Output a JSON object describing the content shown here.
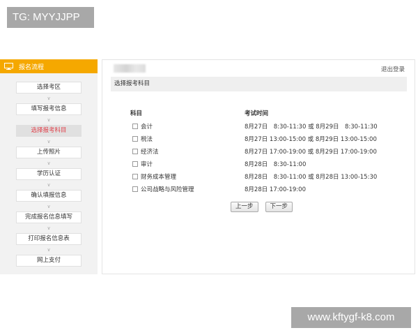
{
  "watermarks": {
    "top": "TG: MYYJJPP",
    "bottom": "www.kftygf-k8.com"
  },
  "sidebar": {
    "header": "报名流程",
    "header_icon": "monitor-icon",
    "accent_color": "#f5a800",
    "active_color": "#e0404a",
    "steps": [
      {
        "label": "选择考区",
        "active": false
      },
      {
        "label": "填写报考信息",
        "active": false
      },
      {
        "label": "选择报考科目",
        "active": true
      },
      {
        "label": "上传照片",
        "active": false
      },
      {
        "label": "学历认证",
        "active": false
      },
      {
        "label": "确认填报信息",
        "active": false
      },
      {
        "label": "完成报名信息填写",
        "active": false
      },
      {
        "label": "打印报名信息表",
        "active": false
      },
      {
        "label": "网上支付",
        "active": false
      }
    ],
    "arrow_glyph": "∨"
  },
  "main": {
    "logout": "退出登录",
    "section_title": "选择报考科目",
    "columns": {
      "subject": "科目",
      "time": "考试时间"
    },
    "subjects": [
      {
        "name": "会计",
        "time": "8月27日　8:30-11:30 或 8月29日　8:30-11:30",
        "checked": false
      },
      {
        "name": "税法",
        "time": "8月27日 13:00-15:00 或 8月29日 13:00-15:00",
        "checked": false
      },
      {
        "name": "经济法",
        "time": "8月27日 17:00-19:00 或 8月29日 17:00-19:00",
        "checked": false
      },
      {
        "name": "审计",
        "time": "8月28日　8:30-11:00",
        "checked": false
      },
      {
        "name": "财务成本管理",
        "time": "8月28日　8:30-11:00 或 8月28日 13:00-15:30",
        "checked": false
      },
      {
        "name": "公司战略与风险管理",
        "time": "8月28日 17:00-19:00",
        "checked": false
      }
    ],
    "buttons": {
      "prev": "上一步",
      "next": "下一步"
    }
  }
}
